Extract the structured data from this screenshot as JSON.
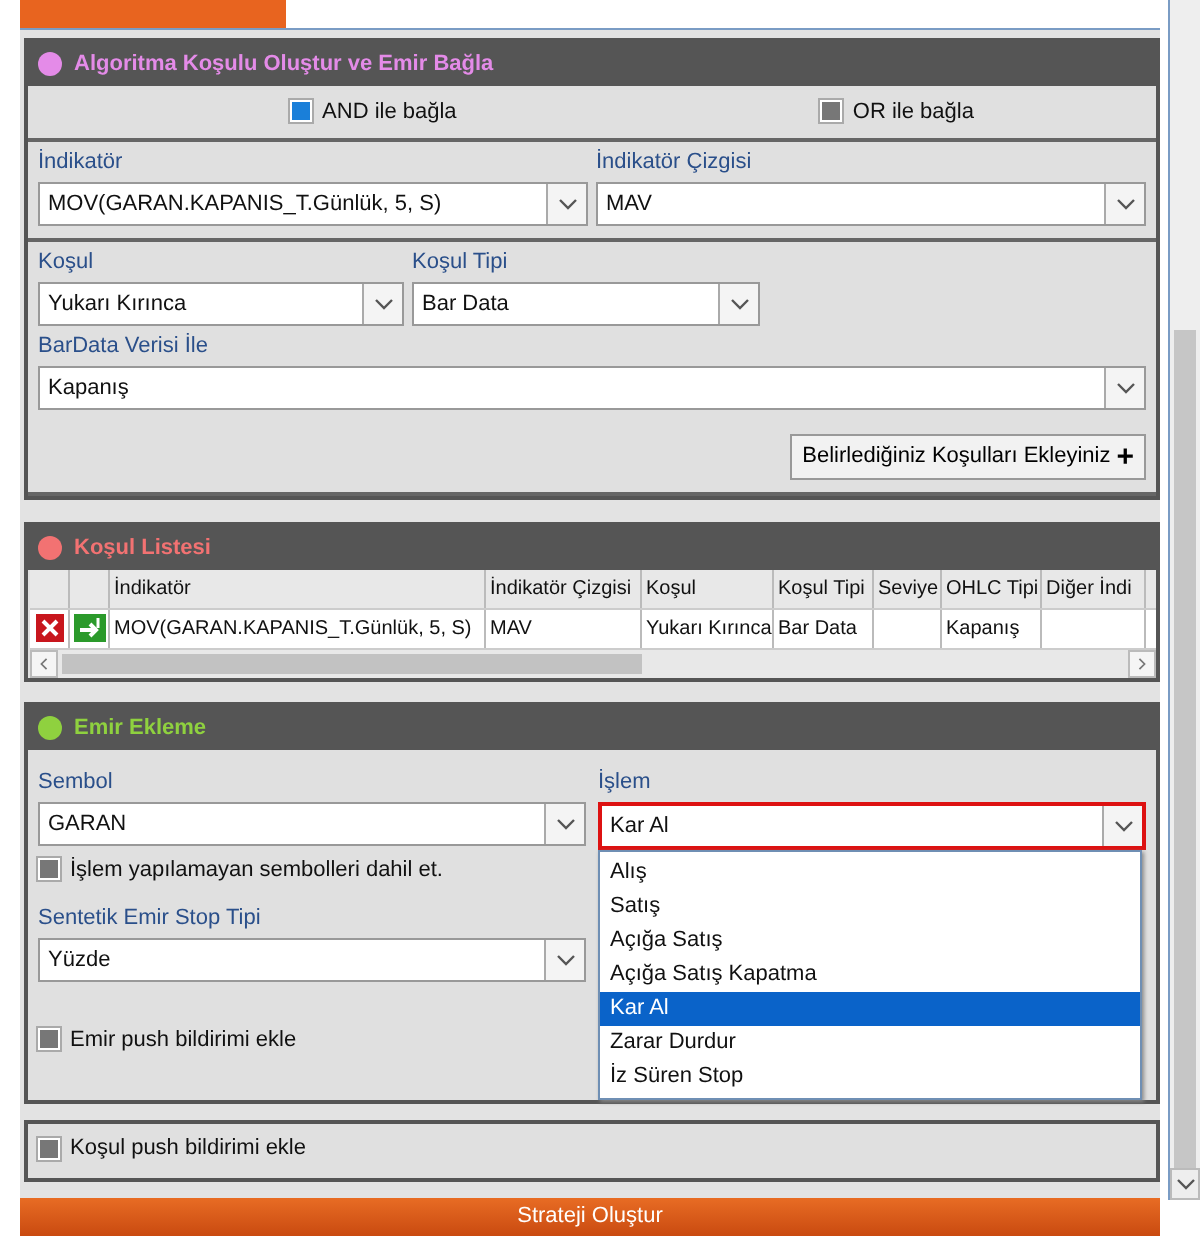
{
  "condition_builder": {
    "title": "Algoritma Koşulu Oluştur ve Emir Bağla",
    "color": "#e48be8",
    "connectors": [
      {
        "label": "AND ile bağla",
        "checked": true
      },
      {
        "label": "OR ile bağla",
        "checked": false
      }
    ],
    "indicator": {
      "label": "İndikatör",
      "value": "MOV(GARAN.KAPANIS_T.Günlük, 5, S)"
    },
    "indicator_line": {
      "label": "İndikatör Çizgisi",
      "value": "MAV"
    },
    "condition": {
      "label": "Koşul",
      "value": "Yukarı Kırınca"
    },
    "condition_type": {
      "label": "Koşul Tipi",
      "value": "Bar Data"
    },
    "bar_data": {
      "label": "BarData Verisi İle",
      "value": "Kapanış"
    },
    "add_button": {
      "label": "Belirlediğiniz Koşulları Ekleyiniz",
      "icon": "+"
    }
  },
  "condition_list": {
    "title": "Koşul Listesi",
    "color": "#f27272",
    "columns": [
      "İndikatör",
      "İndikatör Çizgisi",
      "Koşul",
      "Koşul Tipi",
      "Seviye",
      "OHLC Tipi",
      "Diğer İndi"
    ],
    "rows": [
      {
        "cells": [
          "MOV(GARAN.KAPANIS_T.Günlük, 5, S)",
          "MAV",
          "Yukarı Kırınca",
          "Bar Data",
          "",
          "Kapanış",
          ""
        ]
      }
    ]
  },
  "order_entry": {
    "title": "Emir Ekleme",
    "color": "#8fd13f",
    "symbol": {
      "label": "Sembol",
      "value": "GARAN"
    },
    "include_untradable": {
      "label": "İşlem yapılamayan sembolleri dahil et.",
      "checked": false
    },
    "stop_type": {
      "label": "Sentetik Emir Stop Tipi",
      "value": "Yüzde"
    },
    "push": {
      "label": "Emir push bildirimi ekle",
      "checked": false
    },
    "operation": {
      "label": "İşlem",
      "value": "Kar Al",
      "expanded": true,
      "options": [
        {
          "label": "Alış",
          "selected": false
        },
        {
          "label": "Satış",
          "selected": false
        },
        {
          "label": "Açığa Satış",
          "selected": false
        },
        {
          "label": "Açığa Satış Kapatma",
          "selected": false
        },
        {
          "label": "Kar Al",
          "selected": true
        },
        {
          "label": "Zarar Durdur",
          "selected": false
        },
        {
          "label": "İz Süren Stop",
          "selected": false
        }
      ]
    }
  },
  "condition_push": {
    "label": "Koşul push bildirimi ekle",
    "checked": false
  },
  "create_button": {
    "label": "Strateji Oluştur"
  }
}
